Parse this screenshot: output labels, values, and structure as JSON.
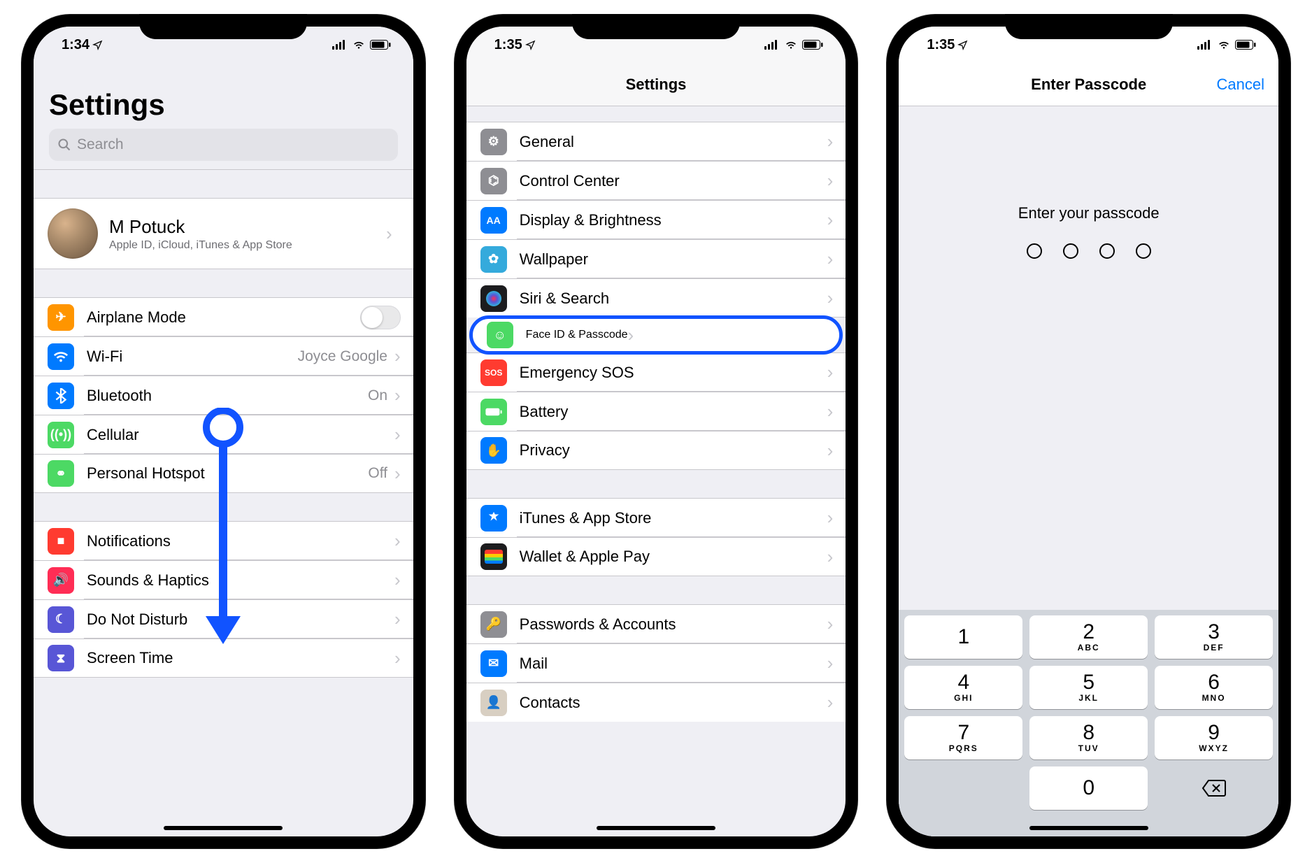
{
  "phone1": {
    "status_time": "1:34",
    "title": "Settings",
    "search_placeholder": "Search",
    "profile": {
      "name": "M Potuck",
      "subtitle": "Apple ID, iCloud, iTunes & App Store"
    },
    "groupA": [
      {
        "icon": "airplane",
        "color": "c-orange",
        "label": "Airplane Mode",
        "toggle": false
      },
      {
        "icon": "wifi",
        "color": "c-blue",
        "label": "Wi-Fi",
        "value": "Joyce Google"
      },
      {
        "icon": "bluetooth",
        "color": "c-blue",
        "label": "Bluetooth",
        "value": "On"
      },
      {
        "icon": "antenna",
        "color": "c-green",
        "label": "Cellular"
      },
      {
        "icon": "link",
        "color": "c-green",
        "label": "Personal Hotspot",
        "value": "Off"
      }
    ],
    "groupB": [
      {
        "icon": "bell",
        "color": "c-red",
        "label": "Notifications"
      },
      {
        "icon": "speaker",
        "color": "c-pink",
        "label": "Sounds & Haptics"
      },
      {
        "icon": "moon",
        "color": "c-purple",
        "label": "Do Not Disturb"
      },
      {
        "icon": "hourglass",
        "color": "c-purple",
        "label": "Screen Time"
      }
    ]
  },
  "phone2": {
    "status_time": "1:35",
    "nav_title": "Settings",
    "groupA": [
      {
        "icon": "gear",
        "color": "c-grey",
        "label": "General"
      },
      {
        "icon": "switches",
        "color": "c-grey",
        "label": "Control Center"
      },
      {
        "icon": "aa",
        "color": "c-blue",
        "label": "Display & Brightness"
      },
      {
        "icon": "flower",
        "color": "c-blue2",
        "label": "Wallpaper"
      },
      {
        "icon": "siri",
        "color": "c-black",
        "label": "Siri & Search"
      },
      {
        "icon": "faceid",
        "color": "c-green",
        "label": "Face ID & Passcode",
        "highlight": true
      },
      {
        "icon": "sos",
        "color": "c-red",
        "label": "Emergency SOS"
      },
      {
        "icon": "battery",
        "color": "c-green",
        "label": "Battery"
      },
      {
        "icon": "hand",
        "color": "c-blue",
        "label": "Privacy"
      }
    ],
    "groupB": [
      {
        "icon": "appstore",
        "color": "c-blue",
        "label": "iTunes & App Store"
      },
      {
        "icon": "wallet",
        "color": "c-black",
        "label": "Wallet & Apple Pay"
      }
    ],
    "groupC": [
      {
        "icon": "key",
        "color": "c-grey",
        "label": "Passwords & Accounts"
      },
      {
        "icon": "mail",
        "color": "c-blue",
        "label": "Mail"
      },
      {
        "icon": "contacts",
        "color": "c-grey",
        "label": "Contacts"
      }
    ]
  },
  "phone3": {
    "status_time": "1:35",
    "nav_title": "Enter Passcode",
    "nav_right": "Cancel",
    "prompt": "Enter your passcode",
    "keypad": [
      {
        "d": "1",
        "s": ""
      },
      {
        "d": "2",
        "s": "ABC"
      },
      {
        "d": "3",
        "s": "DEF"
      },
      {
        "d": "4",
        "s": "GHI"
      },
      {
        "d": "5",
        "s": "JKL"
      },
      {
        "d": "6",
        "s": "MNO"
      },
      {
        "d": "7",
        "s": "PQRS"
      },
      {
        "d": "8",
        "s": "TUV"
      },
      {
        "d": "9",
        "s": "WXYZ"
      }
    ],
    "zero": {
      "d": "0",
      "s": ""
    }
  }
}
